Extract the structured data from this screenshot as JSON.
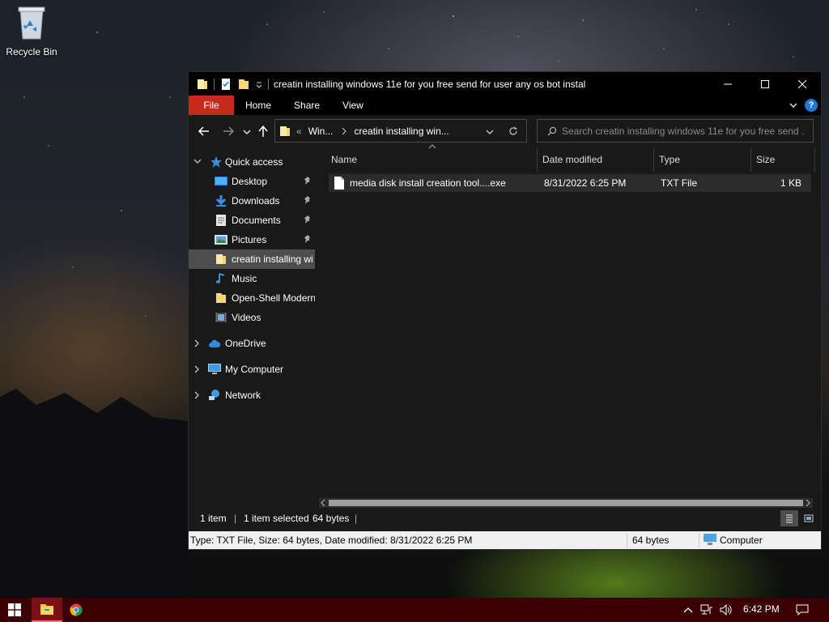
{
  "desktop": {
    "recycle_bin_label": "Recycle Bin"
  },
  "window": {
    "title": "creatin installing windows 11e for you free send for user any os bot instal",
    "ribbon_tabs": [
      "File",
      "Home",
      "Share",
      "View"
    ],
    "address": {
      "overflow": "«",
      "segments": [
        "Win...",
        "creatin installing win..."
      ]
    },
    "search_placeholder": "Search creatin installing windows 11e for you free send ...",
    "nav": {
      "quick_access": "Quick access",
      "items": [
        {
          "label": "Desktop",
          "pinned": true
        },
        {
          "label": "Downloads",
          "pinned": true
        },
        {
          "label": "Documents",
          "pinned": true
        },
        {
          "label": "Pictures",
          "pinned": true
        },
        {
          "label": "creatin installing wi",
          "pinned": false,
          "selected": true
        },
        {
          "label": "Music",
          "pinned": false
        },
        {
          "label": "Open-Shell Modern",
          "pinned": false
        },
        {
          "label": "Videos",
          "pinned": false
        }
      ],
      "onedrive": "OneDrive",
      "my_computer": "My Computer",
      "network": "Network"
    },
    "columns": {
      "name": "Name",
      "date_modified": "Date modified",
      "type": "Type",
      "size": "Size"
    },
    "files": [
      {
        "name": "media disk install creation tool....exe",
        "date_modified": "8/31/2022 6:25 PM",
        "type": "TXT File",
        "size": "1 KB"
      }
    ],
    "status": {
      "item_count": "1 item",
      "selected": "1 item selected",
      "selected_size": "64 bytes"
    },
    "infobar": {
      "details": "Type: TXT File, Size: 64 bytes, Date modified: 8/31/2022 6:25 PM",
      "size": "64 bytes",
      "location": "Computer"
    }
  },
  "taskbar": {
    "clock": "6:42 PM"
  },
  "colors": {
    "file_tab": "#c42b1c",
    "taskbar": "#3a0004",
    "window_bg": "#191919",
    "selection": "#4d4d4d",
    "accent_blue": "#1e78d4"
  }
}
